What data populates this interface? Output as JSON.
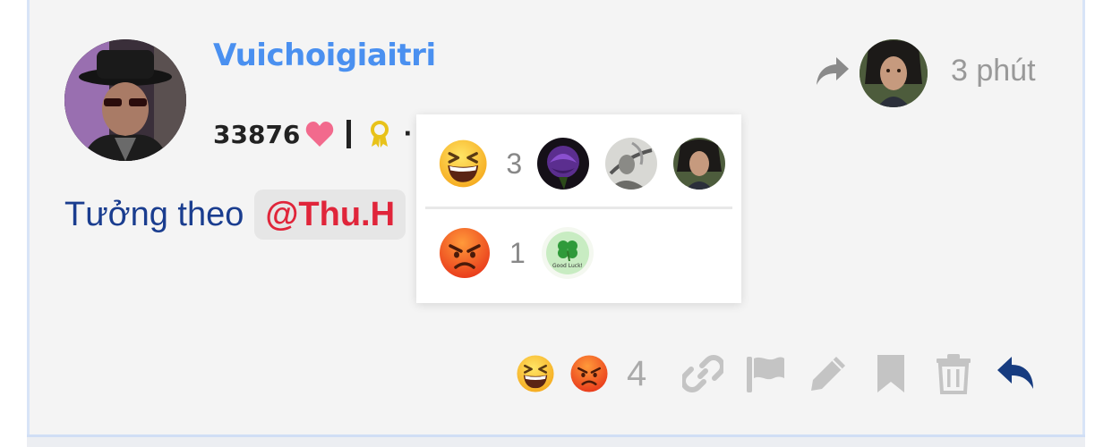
{
  "post": {
    "username": "Vuichoigiaitri",
    "points": "33876",
    "stats_extra": "·",
    "time": "3 phút",
    "content": {
      "prefix": "Tưởng theo",
      "mention": "@Thu.H",
      "suffix": ")"
    }
  },
  "reactions_popup": {
    "rows": [
      {
        "emoji": "laughing-face-icon",
        "count": "3"
      },
      {
        "emoji": "angry-face-icon",
        "count": "1"
      }
    ],
    "good_luck_text": "Good Luck!"
  },
  "actions": {
    "reaction_count": "4",
    "icons": [
      "laughing-face-icon",
      "angry-face-icon",
      "link-icon",
      "flag-icon",
      "pencil-icon",
      "bookmark-icon",
      "trash-icon",
      "reply-icon"
    ]
  },
  "colors": {
    "username": "#4a90f0",
    "content_text": "#1a3d8f",
    "mention": "#e0253a",
    "heart": "#f26a8d",
    "award": "#e8c21a",
    "reply": "#173c80",
    "muted_icons": "#c4c4c4"
  }
}
